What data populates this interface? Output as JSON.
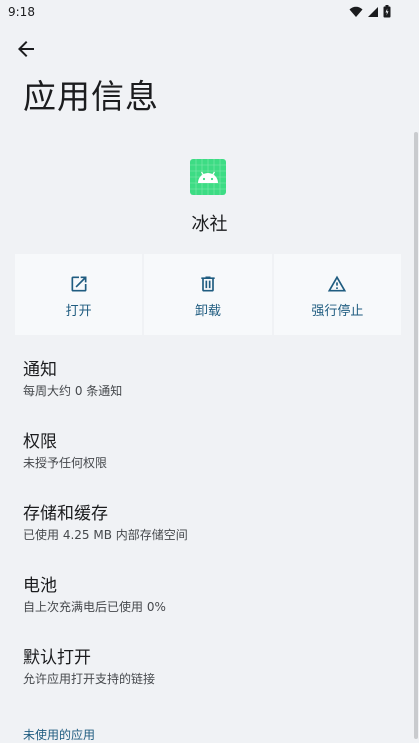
{
  "status": {
    "time": "9:18"
  },
  "header": {
    "title": "应用信息"
  },
  "app": {
    "name": "冰社",
    "icon": "android-icon",
    "icon_color": "#3ddc84"
  },
  "actions": [
    {
      "label": "打开",
      "icon": "open-in-new-icon"
    },
    {
      "label": "卸载",
      "icon": "trash-icon"
    },
    {
      "label": "强行停止",
      "icon": "warning-icon"
    }
  ],
  "settings": [
    {
      "title": "通知",
      "subtitle": "每周大约 0 条通知"
    },
    {
      "title": "权限",
      "subtitle": "未授予任何权限"
    },
    {
      "title": "存储和缓存",
      "subtitle": "已使用 4.25 MB 内部存储空间"
    },
    {
      "title": "电池",
      "subtitle": "自上次充满电后已使用 0%"
    },
    {
      "title": "默认打开",
      "subtitle": "允许应用打开支持的链接"
    }
  ],
  "section": {
    "unused_apps": "未使用的应用"
  },
  "colors": {
    "accent": "#1f5c80",
    "background": "#f0f2f5"
  }
}
